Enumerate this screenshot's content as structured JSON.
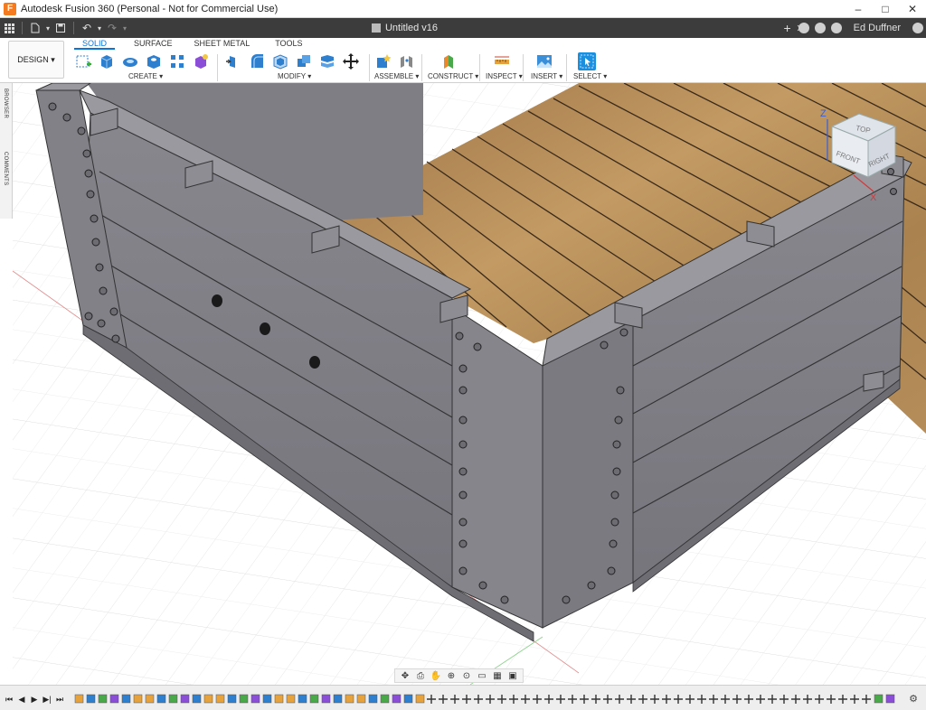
{
  "window": {
    "title": "Autodesk Fusion 360 (Personal - Not for Commercial Use)",
    "logo_letter": "F",
    "minimize": "–",
    "maximize": "□",
    "close": "✕"
  },
  "quickbar": {
    "doc_title": "Untitled v16",
    "user": "Ed Duffner",
    "icons": [
      "grid-icon",
      "file-icon",
      "save-icon",
      "undo-icon",
      "redo-icon"
    ],
    "right_icons": [
      "new-tab-icon",
      "extensions-icon",
      "jobs-icon",
      "help-icon"
    ]
  },
  "toolbar": {
    "workspace": "DESIGN ▾",
    "tabs": [
      {
        "label": "SOLID",
        "active": true
      },
      {
        "label": "SURFACE",
        "active": false
      },
      {
        "label": "SHEET METAL",
        "active": false
      },
      {
        "label": "TOOLS",
        "active": false
      }
    ],
    "groups": {
      "create": "CREATE ▾",
      "modify": "MODIFY ▾",
      "assemble": "ASSEMBLE ▾",
      "construct": "CONSTRUCT ▾",
      "inspect": "INSPECT ▾",
      "insert": "INSERT ▾",
      "select": "SELECT ▾"
    },
    "colors": {
      "active_tab": "#0a74da",
      "create_icons": "#2f7fcf",
      "create_accent": "#8a4fd6",
      "construct_orange": "#e88a2b",
      "construct_green": "#4aa84a",
      "inspect_ruler": "#e6a23c",
      "select_blue": "#1a8fe0"
    }
  },
  "sidepanel": {
    "browser": "BROWSER",
    "comments": "COMMENTS"
  },
  "viewcube": {
    "top": "TOP",
    "front": "FRONT",
    "right": "RIGHT",
    "z_axis": "Z",
    "x_axis": "X"
  },
  "navbar": {
    "icons": [
      "orbit-icon",
      "look-at-icon",
      "pan-icon",
      "zoom-icon",
      "fit-icon",
      "display-settings-icon",
      "grid-settings-icon",
      "viewports-icon"
    ]
  },
  "timeline": {
    "controls": [
      "⏮",
      "◀",
      "▶",
      "▶|",
      "⏭"
    ],
    "settings": "⚙"
  },
  "model": {
    "wall_color": "#7e7d84",
    "wall_dark": "#6b6a72",
    "deck_color": "#b98d57",
    "deck_dark": "#8c6a40"
  }
}
